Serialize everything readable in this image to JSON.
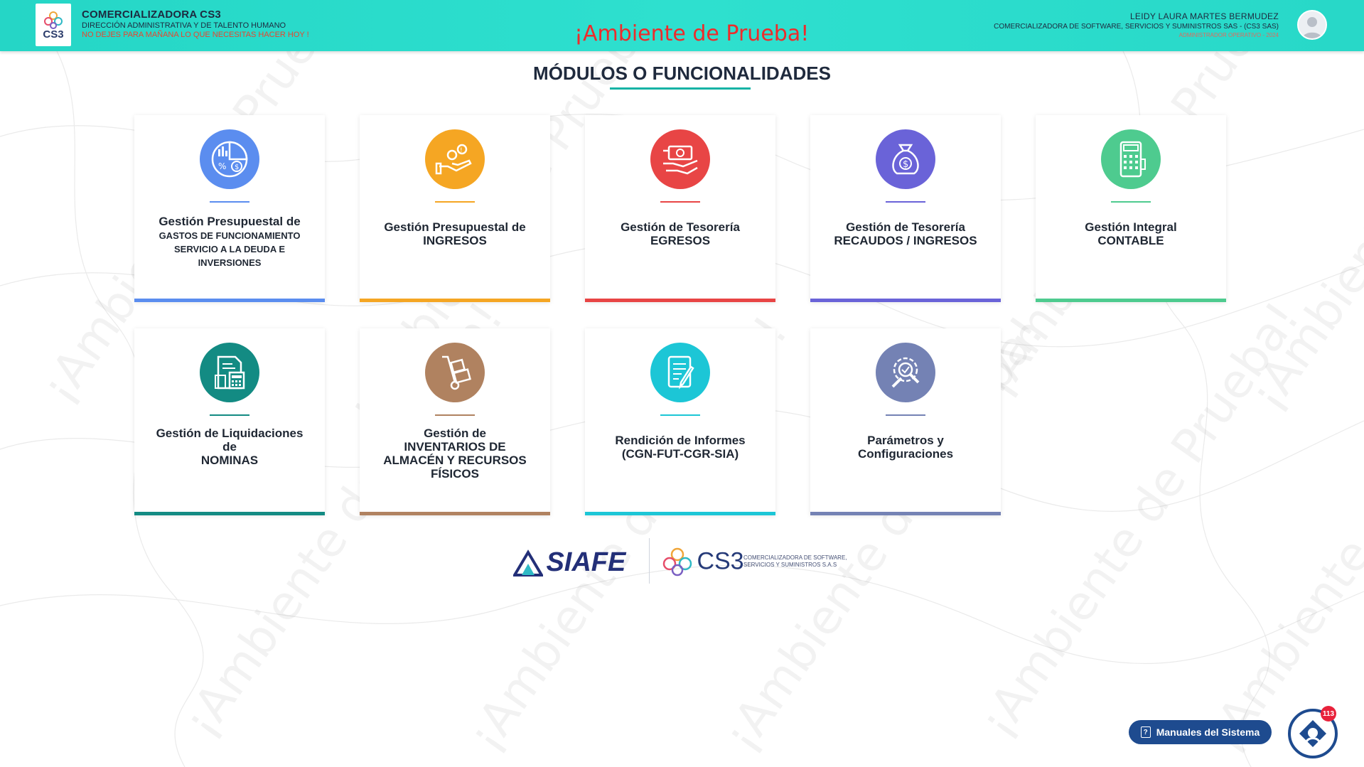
{
  "header": {
    "logo_text": "CS3",
    "company": "COMERCIALIZADORA CS3",
    "department": "DIRECCIÓN ADMINISTRATIVA Y DE TALENTO HUMANO",
    "slogan": "NO DEJES PARA MAÑANA LO QUE NECESITAS HACER HOY !",
    "environment": "¡Ambiente de Prueba!",
    "user_name": "LEIDY LAURA MARTES BERMUDEZ",
    "user_company": "COMERCIALIZADORA DE SOFTWARE, SERVICIOS Y SUMINISTROS SAS - (CS3 SAS)",
    "user_role": "ADMINISTRADOR OPERATIVO - 2024"
  },
  "page": {
    "title": "MÓDULOS O FUNCIONALIDADES",
    "watermark": "¡Ambiente de Prueba!",
    "watermark_fragments": [
      "Prueba!",
      "¡Ambiente de Prueba!"
    ]
  },
  "modules": [
    {
      "line1": "Gestión Presupuestal de",
      "sub": "GASTOS DE FUNCIONAMIENTO SERVICIO A LA DEUDA E INVERSIONES",
      "color": "#5b8def",
      "icon": "budget-chart-icon"
    },
    {
      "line1": "Gestión Presupuestal de",
      "line2": "INGRESOS",
      "color": "#f5a623",
      "icon": "hand-coins-icon"
    },
    {
      "line1": "Gestión de Tesorería",
      "line2": "EGRESOS",
      "color": "#e84545",
      "icon": "cash-payment-icon"
    },
    {
      "line1": "Gestión de Tesorería",
      "line2": "RECAUDOS / INGRESOS",
      "color": "#6a63d8",
      "icon": "money-bag-icon"
    },
    {
      "line1": "Gestión Integral",
      "line2": "CONTABLE",
      "color": "#4ecb8f",
      "icon": "cash-register-icon"
    },
    {
      "line1": "Gestión de Liquidaciones",
      "line2": "de",
      "line3": "NOMINAS",
      "color": "#138b83",
      "icon": "payroll-calculator-icon"
    },
    {
      "line1": "Gestión de",
      "line2": "INVENTARIOS DE",
      "line3": "ALMACÉN Y RECURSOS",
      "line4": "FÍSICOS",
      "color": "#b08260",
      "icon": "hand-truck-icon"
    },
    {
      "line1": "Rendición de Informes",
      "line2": "(CGN-FUT-CGR-SIA)",
      "color": "#1cc6d6",
      "icon": "report-document-icon"
    },
    {
      "line1": "Parámetros y",
      "line2": "Configuraciones",
      "color": "#7482b4",
      "icon": "settings-gear-icon"
    }
  ],
  "footer": {
    "siafe_logo": "SIAFE",
    "cs3_logo": "CS3",
    "cs3_desc_line1": "COMERCIALIZADORA DE SOFTWARE,",
    "cs3_desc_line2": "SERVICIOS Y SUMINISTROS S.A.S"
  },
  "help": {
    "manuals_label": "Manuales del Sistema",
    "badge_count": "113"
  }
}
